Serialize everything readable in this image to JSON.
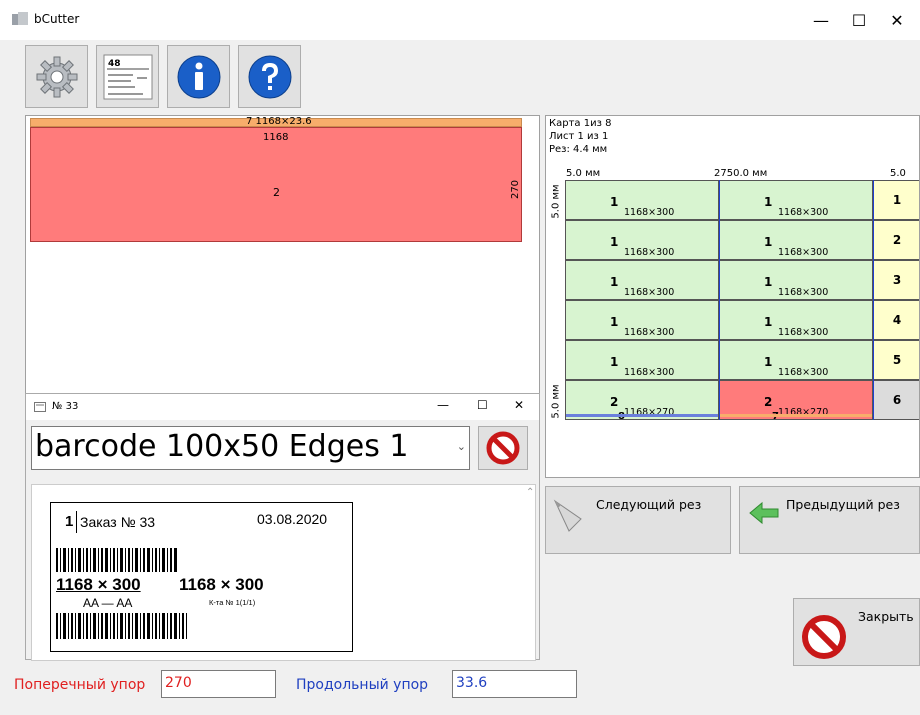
{
  "window": {
    "title": "bCutter",
    "minimize": "—",
    "maximize": "☐",
    "close": "✕"
  },
  "toolbar": {
    "settings_icon": "gear-icon",
    "label_icon": "label-template-icon",
    "label_num": "48",
    "info_icon": "info-icon",
    "help_icon": "help-icon"
  },
  "left_canvas": {
    "top_piece_label": "7  1168×23.6",
    "width_label": "1168",
    "piece_number": "2",
    "height_label": "270",
    "colors": {
      "top_piece": "#f7ad6b",
      "main_piece": "#ff7b7b"
    }
  },
  "right_panel": {
    "info_lines": [
      "Карта 1из 8",
      "Лист 1 из 1",
      "Рез: 4.4 мм"
    ],
    "top_left_margin": "5.0 мм",
    "top_width": "2750.0 мм",
    "top_right_margin": "5.0 мм",
    "left_top_margin": "5.0 мм",
    "left_bottom_margin": "5.0 мм",
    "rows": [
      {
        "cells": [
          {
            "n": "1",
            "d": "1168×300"
          },
          {
            "n": "1",
            "d": "1168×300"
          }
        ],
        "right": "1"
      },
      {
        "cells": [
          {
            "n": "1",
            "d": "1168×300"
          },
          {
            "n": "1",
            "d": "1168×300"
          }
        ],
        "right": "2"
      },
      {
        "cells": [
          {
            "n": "1",
            "d": "1168×300"
          },
          {
            "n": "1",
            "d": "1168×300"
          }
        ],
        "right": "3"
      },
      {
        "cells": [
          {
            "n": "1",
            "d": "1168×300"
          },
          {
            "n": "1",
            "d": "1168×300"
          }
        ],
        "right": "4"
      },
      {
        "cells": [
          {
            "n": "1",
            "d": "1168×300"
          },
          {
            "n": "1",
            "d": "1168×300"
          }
        ],
        "right": "5"
      },
      {
        "cells": [
          {
            "n": "2",
            "d": "1168×270",
            "sub": "8"
          },
          {
            "n": "2",
            "d": "1168×270",
            "sub": "7"
          }
        ],
        "right": "6"
      }
    ]
  },
  "dialog": {
    "title": "№ 33",
    "template": "barcode 100x50 Edges 1",
    "label": {
      "qty": "1",
      "order": "Заказ № 33",
      "date": "03.08.2020",
      "size1": "1168 × 300",
      "size2": "1168 × 300",
      "edges": "AA — AA",
      "card": "К-та № 1(1/1)"
    }
  },
  "buttons": {
    "next_cut": "Следующий рез",
    "prev_cut": "Предыдущий рез",
    "close": "Закрыть"
  },
  "fields": {
    "cross_stop_label": "Поперечный упор",
    "cross_stop_value": "270",
    "long_stop_label": "Продольный упор",
    "long_stop_value": "33.6",
    "colors": {
      "cross": "#e02020",
      "long": "#2040c0"
    }
  }
}
